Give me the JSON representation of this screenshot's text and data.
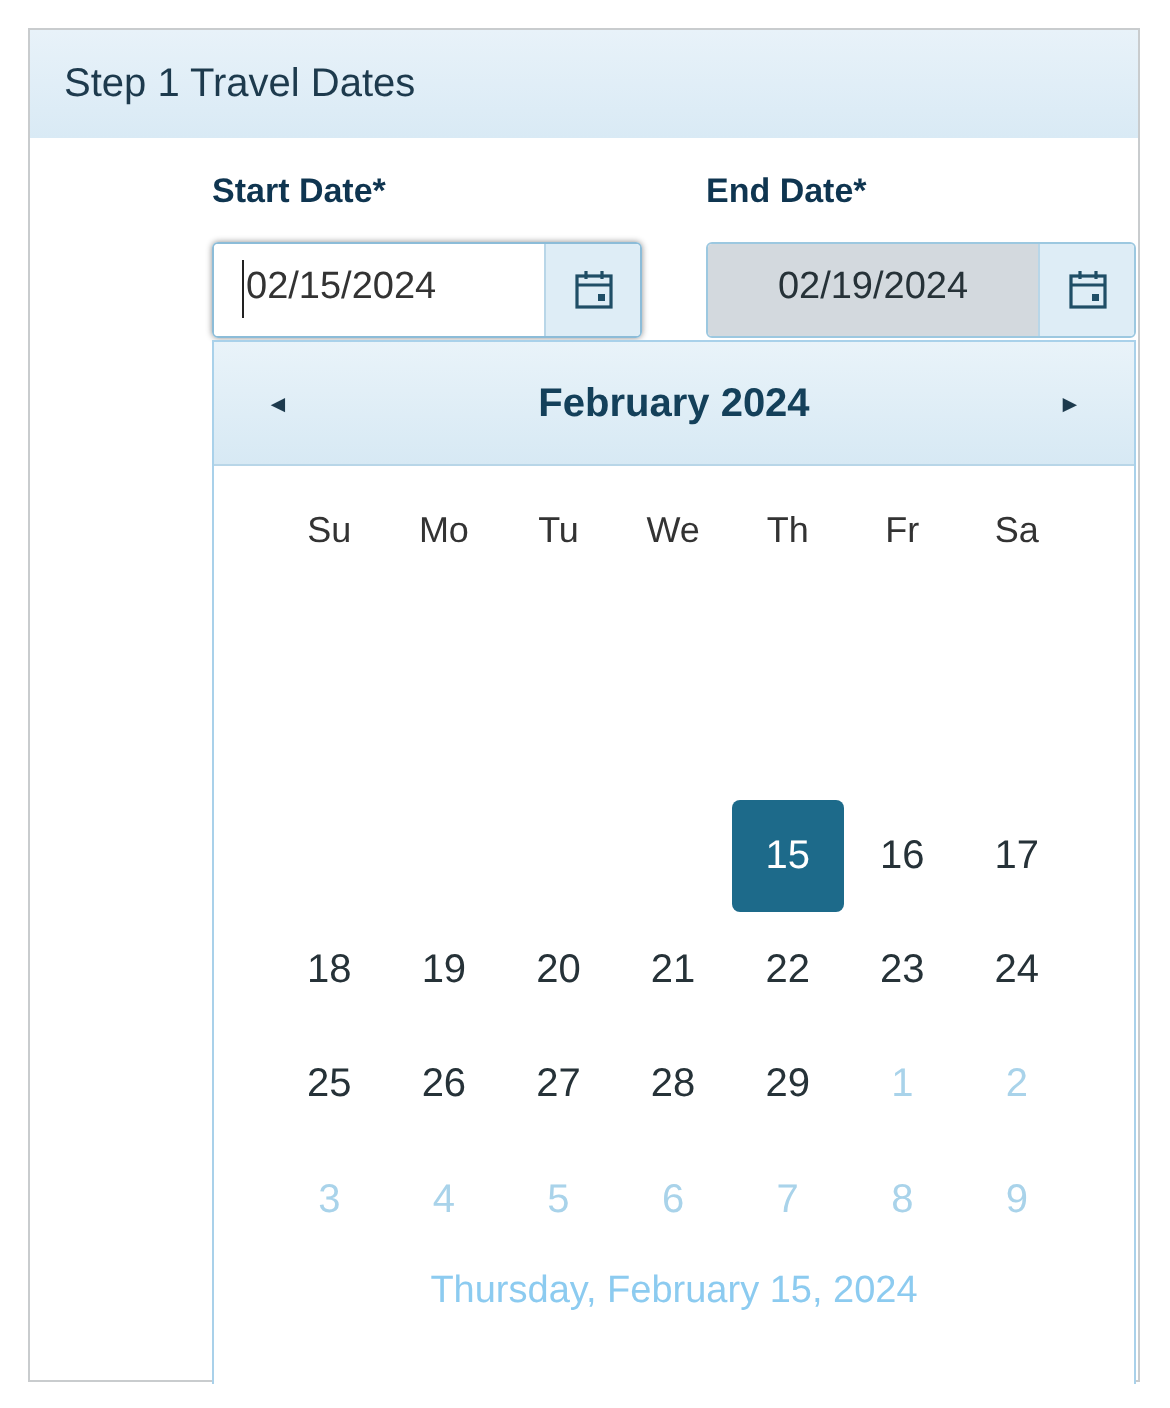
{
  "panel": {
    "title": "Step 1 Travel Dates"
  },
  "fields": [
    {
      "label": "Start Date*",
      "value": "02/15/2024",
      "focused": true,
      "disabled": false
    },
    {
      "label": "End Date*",
      "value": "02/19/2024",
      "focused": false,
      "disabled": true
    }
  ],
  "calendar": {
    "month": "February 2024",
    "prev": "◄",
    "next": "►",
    "weekdays": [
      "Su",
      "Mo",
      "Tu",
      "We",
      "Th",
      "Fr",
      "Sa"
    ],
    "weeks": [
      [
        {
          "kind": "blank"
        },
        {
          "kind": "blank"
        },
        {
          "kind": "blank"
        },
        {
          "kind": "blank"
        },
        {
          "kind": "blank"
        },
        {
          "kind": "blank"
        },
        {
          "kind": "blank"
        }
      ],
      [
        {
          "kind": "blank"
        },
        {
          "kind": "blank"
        },
        {
          "kind": "blank"
        },
        {
          "kind": "blank"
        },
        {
          "kind": "blank"
        },
        {
          "kind": "blank"
        },
        {
          "kind": "blank"
        }
      ],
      [
        {
          "kind": "blank"
        },
        {
          "kind": "blank"
        },
        {
          "kind": "blank"
        },
        {
          "kind": "blank"
        },
        {
          "kind": "day",
          "day": "15",
          "selected": true
        },
        {
          "kind": "day",
          "day": "16",
          "selected": false
        },
        {
          "kind": "day",
          "day": "17",
          "selected": false
        }
      ],
      [
        {
          "kind": "day",
          "day": "18",
          "selected": false
        },
        {
          "kind": "day",
          "day": "19",
          "selected": false
        },
        {
          "kind": "day",
          "day": "20",
          "selected": false
        },
        {
          "kind": "day",
          "day": "21",
          "selected": false
        },
        {
          "kind": "day",
          "day": "22",
          "selected": false
        },
        {
          "kind": "day",
          "day": "23",
          "selected": false
        },
        {
          "kind": "day",
          "day": "24",
          "selected": false
        }
      ],
      [
        {
          "kind": "day",
          "day": "25",
          "selected": false
        },
        {
          "kind": "day",
          "day": "26",
          "selected": false
        },
        {
          "kind": "day",
          "day": "27",
          "selected": false
        },
        {
          "kind": "day",
          "day": "28",
          "selected": false
        },
        {
          "kind": "day",
          "day": "29",
          "selected": false
        },
        {
          "kind": "other",
          "day": "1",
          "selected": false
        },
        {
          "kind": "other",
          "day": "2",
          "selected": false
        }
      ],
      [
        {
          "kind": "other",
          "day": "3",
          "selected": false
        },
        {
          "kind": "other",
          "day": "4",
          "selected": false
        },
        {
          "kind": "other",
          "day": "5",
          "selected": false
        },
        {
          "kind": "other",
          "day": "6",
          "selected": false
        },
        {
          "kind": "other",
          "day": "7",
          "selected": false
        },
        {
          "kind": "other",
          "day": "8",
          "selected": false
        },
        {
          "kind": "other",
          "day": "9",
          "selected": false
        }
      ]
    ],
    "footer": "Thursday, February 15, 2024"
  }
}
